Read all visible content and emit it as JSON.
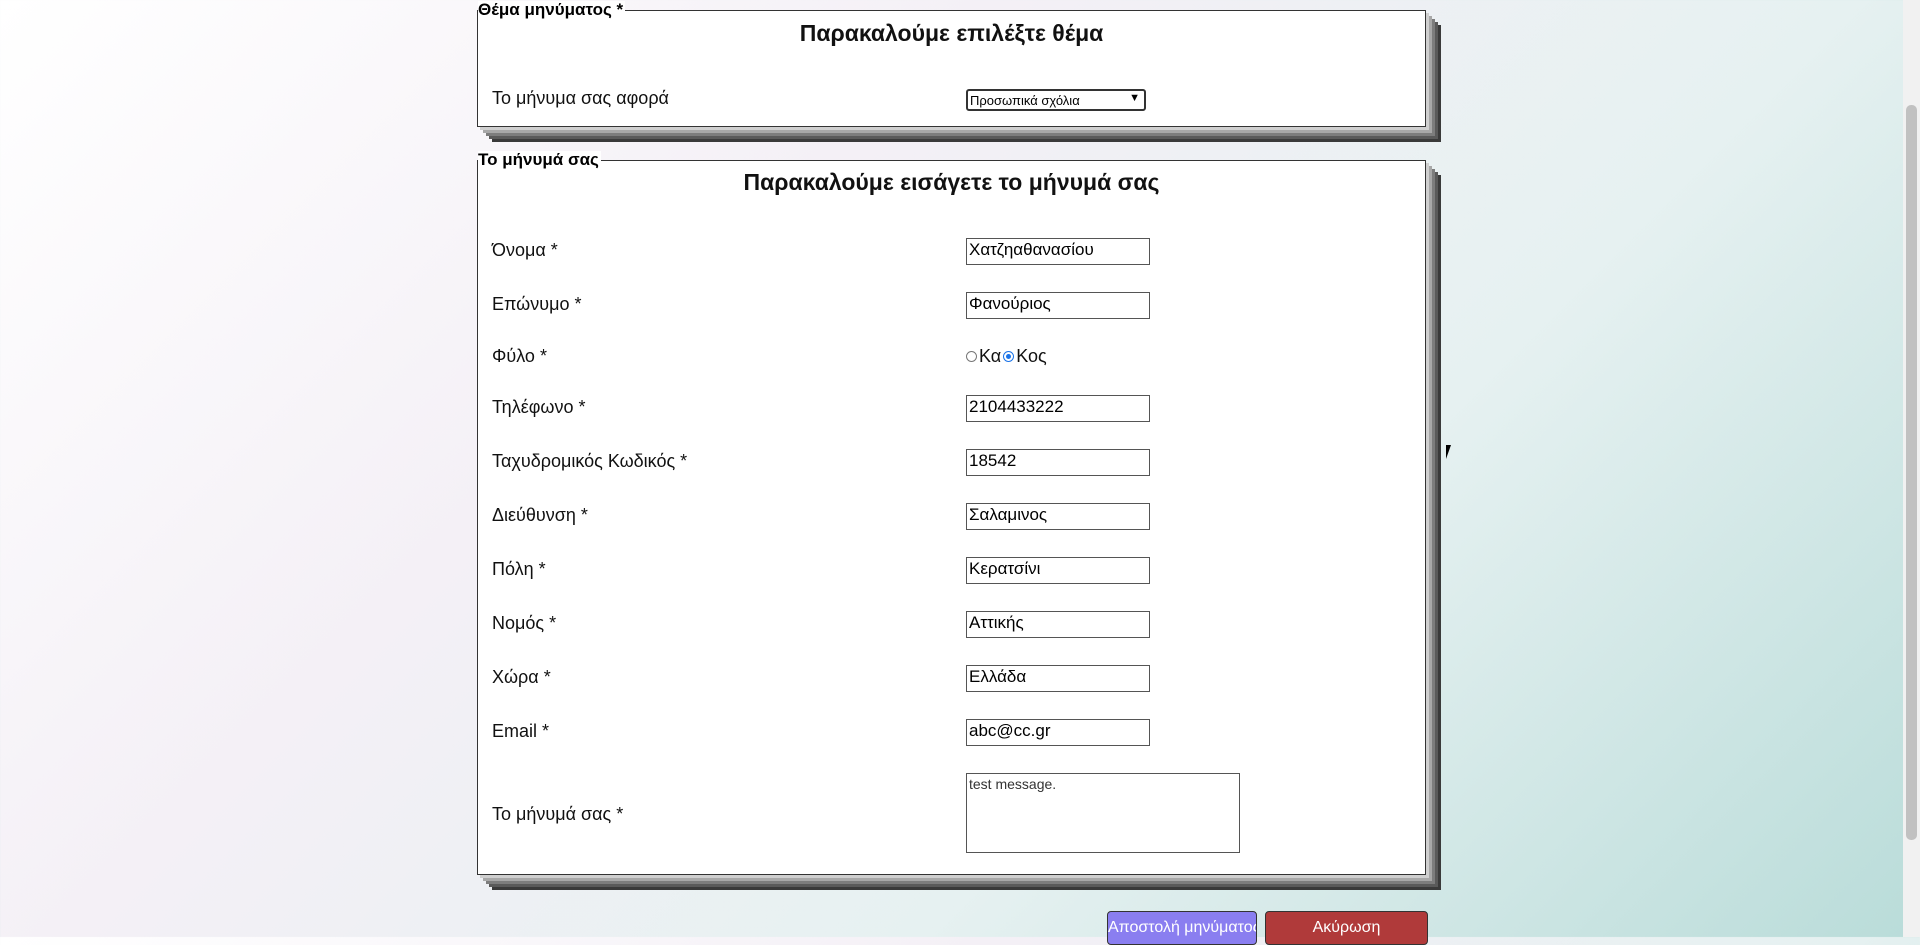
{
  "subject_section": {
    "legend": "Θέμα μηνύματος *",
    "title": "Παρακαλούμε επιλέξτε θέμα",
    "label": "Το μήνυμα σας αφορά",
    "selected": "Προσωπικά σχόλια"
  },
  "message_section": {
    "legend": "Το μήνυμά σας",
    "title": "Παρακαλούμε εισάγετε το μήνυμά σας",
    "fields": {
      "first_name": {
        "label": "Όνομα *",
        "value": "Χατζηαθανασίου"
      },
      "last_name": {
        "label": "Επώνυμο *",
        "value": "Φανούριος"
      },
      "gender": {
        "label": "Φύλο *",
        "option_female": "Κα",
        "option_male": "Κος",
        "selected": "Κος"
      },
      "phone": {
        "label": "Τηλέφωνο *",
        "value": "2104433222"
      },
      "postal_code": {
        "label": "Ταχυδρομικός Κωδικός *",
        "value": "18542"
      },
      "address": {
        "label": "Διεύθυνση *",
        "value": "Σαλαμινος"
      },
      "city": {
        "label": "Πόλη *",
        "value": "Κερατσίνι"
      },
      "prefecture": {
        "label": "Νομός *",
        "value": "Αττικής"
      },
      "country": {
        "label": "Χώρα *",
        "value": "Ελλάδα"
      },
      "email": {
        "label": "Email *",
        "value": "abc@cc.gr"
      },
      "message": {
        "label": "Το μήνυμά σας *",
        "value": "test message."
      }
    }
  },
  "buttons": {
    "send": "Αποστολή μηνύματος",
    "cancel": "Ακύρωση"
  }
}
